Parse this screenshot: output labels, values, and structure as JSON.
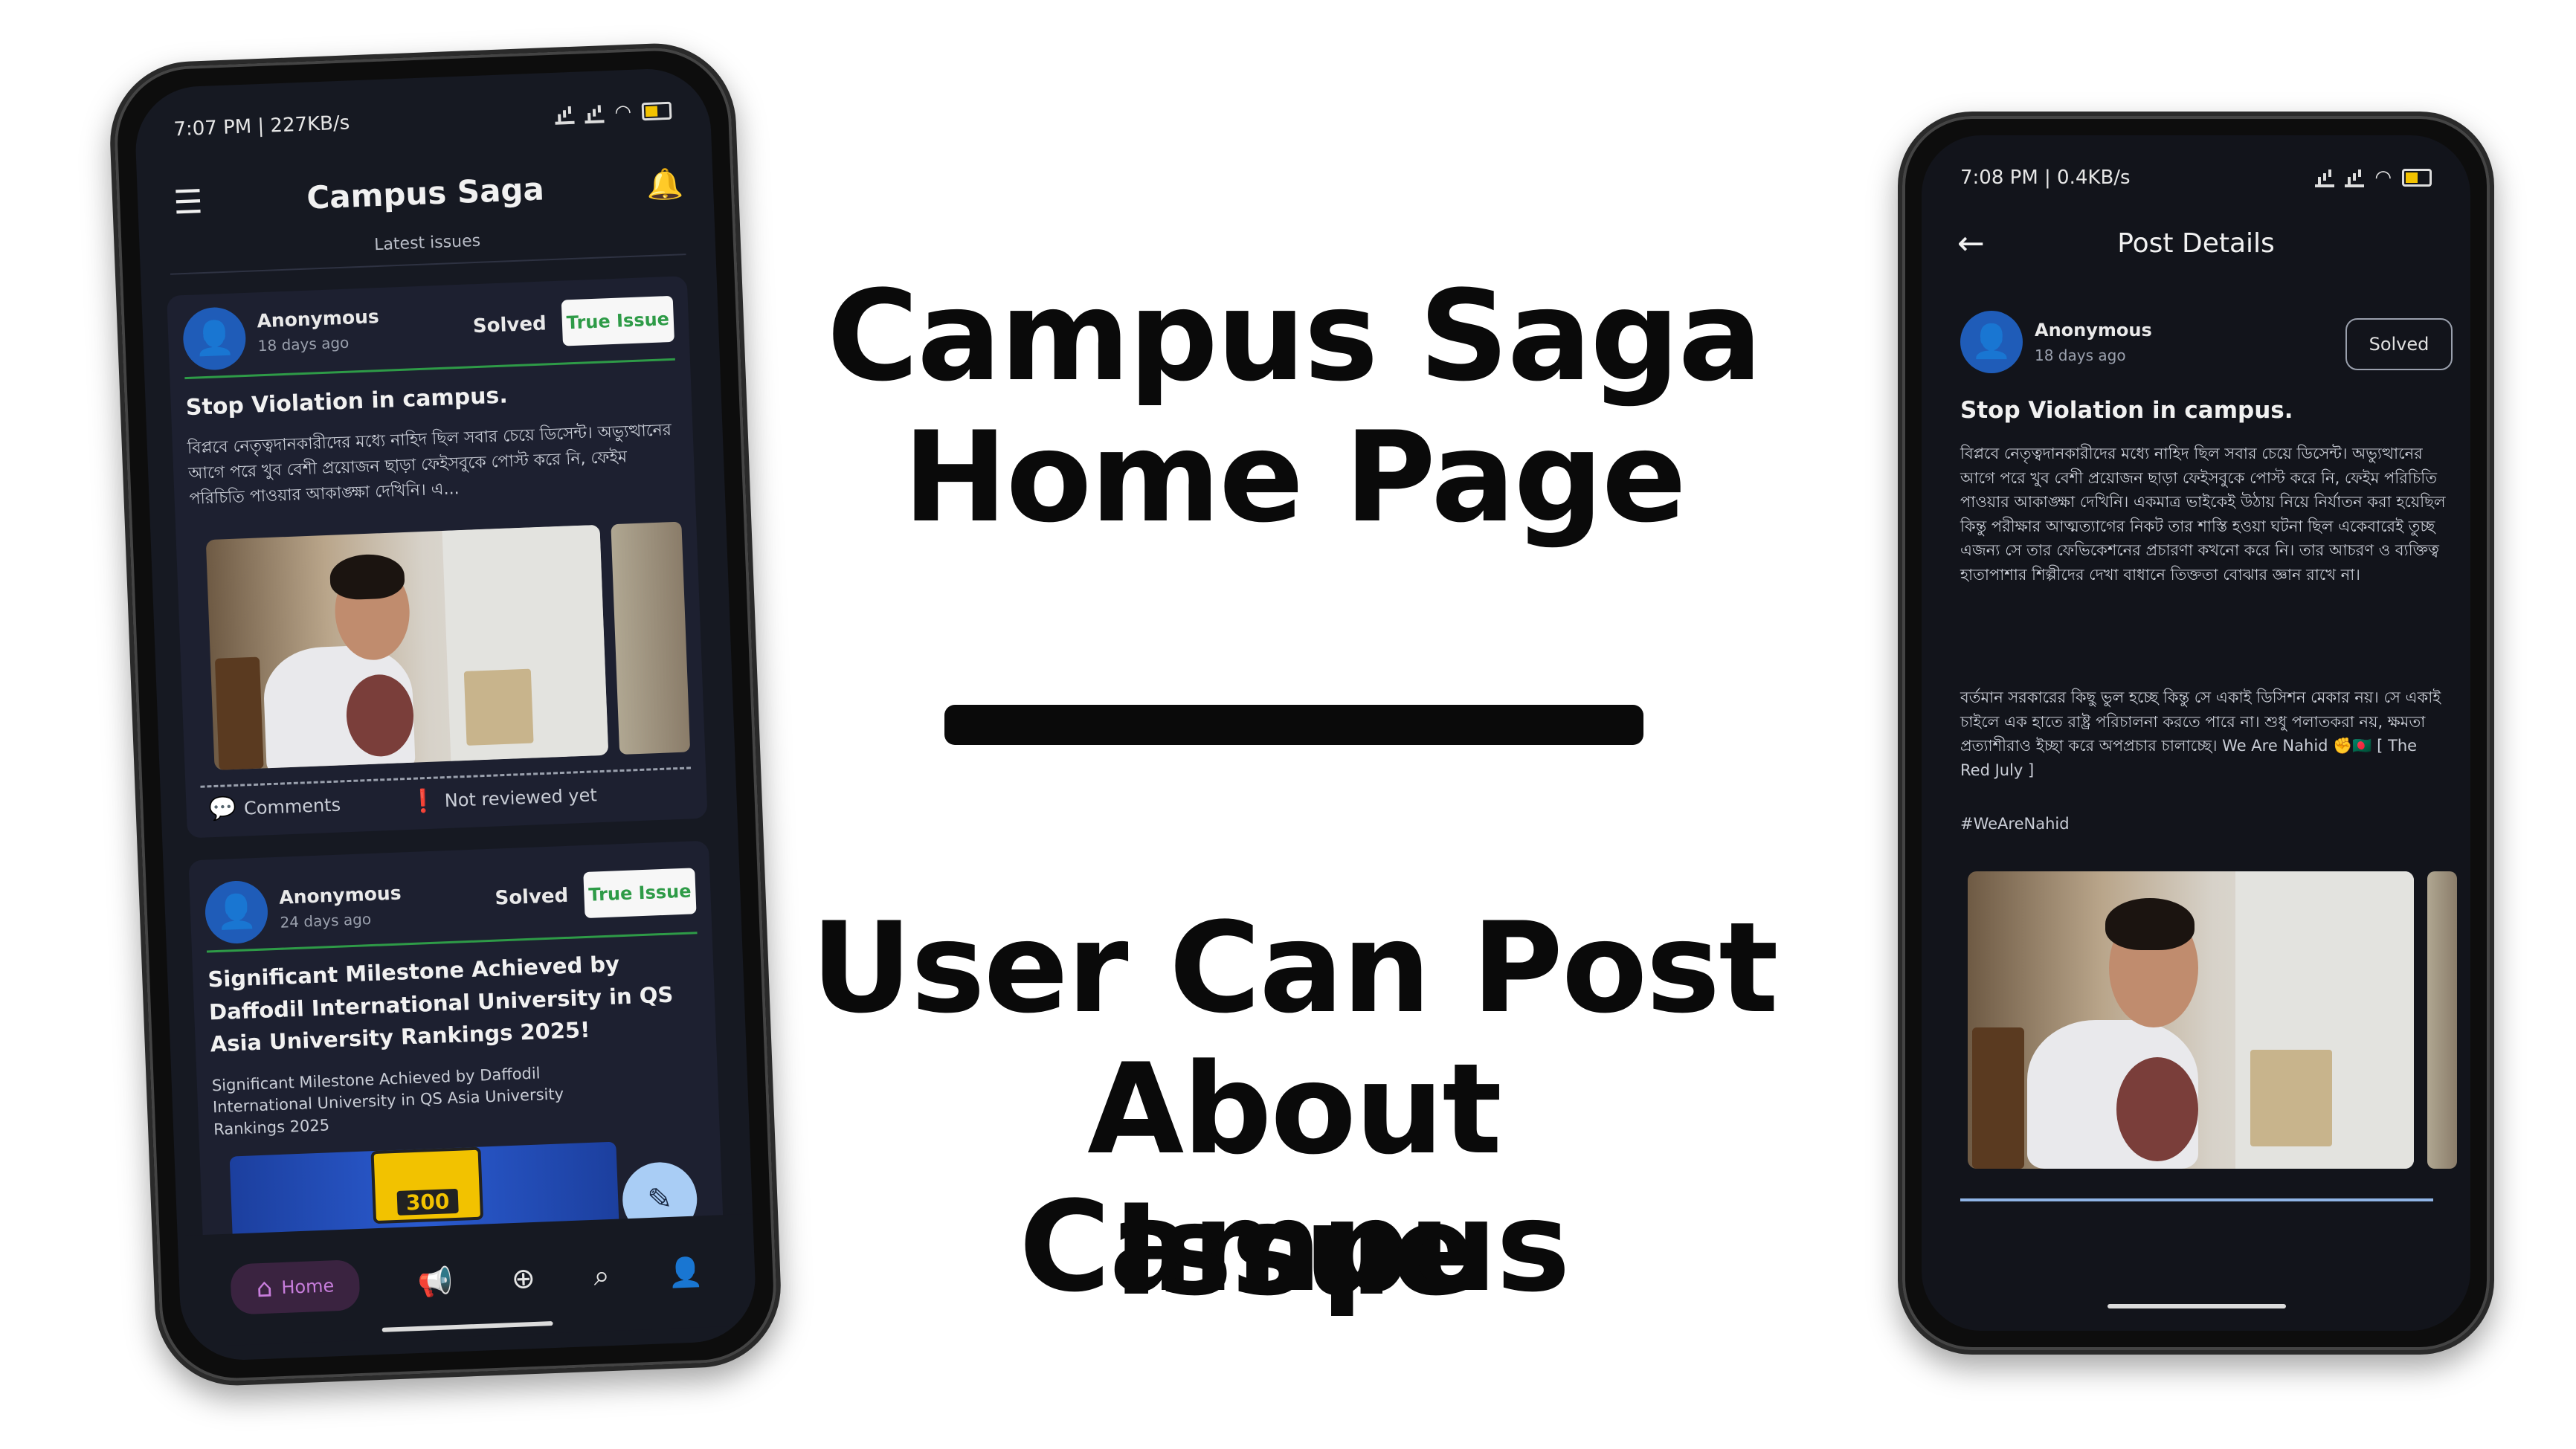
{
  "headline": {
    "line1": "Campus Saga",
    "line2": "Home Page"
  },
  "subheadline": {
    "line1": "User Can Post",
    "line2": "About Campus",
    "line3": "Issue"
  },
  "left_phone": {
    "status": {
      "time": "7:07 PM | 227KB/s"
    },
    "appbar": {
      "title": "Campus Saga",
      "subtitle": "Latest issues"
    },
    "post1": {
      "author": "Anonymous",
      "time": "18 days ago",
      "status": "Solved",
      "chip": "True Issue",
      "title": "Stop Violation in campus.",
      "body": "বিপ্লবে নেতৃত্বদানকারীদের মধ্যে নাহিদ ছিল সবার চেয়ে ডিসেন্ট। অভ্যুত্থানের আগে পরে খুব বেশী প্রয়োজন ছাড়া ফেইসবুকে পোস্ট করে নি, ফেইম পরিচিতি পাওয়ার আকাঙ্ক্ষা দেখিনি। এ...",
      "comments": "Comments",
      "review": "Not reviewed yet"
    },
    "post2": {
      "author": "Anonymous",
      "time": "24 days ago",
      "status": "Solved",
      "chip": "True Issue",
      "title": "Significant Milestone Achieved by Daffodil International University in QS Asia University Rankings 2025!",
      "body": "Significant Milestone Achieved by Daffodil International University in QS Asia University Rankings 2025",
      "badge": "300"
    },
    "nav": {
      "home": "Home"
    }
  },
  "right_phone": {
    "status": {
      "time": "7:08 PM | 0.4KB/s"
    },
    "appbar": {
      "title": "Post Details"
    },
    "post": {
      "author": "Anonymous",
      "time": "18 days ago",
      "status": "Solved",
      "title": "Stop Violation in campus.",
      "para1": "বিপ্লবে নেতৃত্বদানকারীদের মধ্যে নাহিদ ছিল সবার চেয়ে ডিসেন্ট। অভ্যুত্থানের আগে পরে খুব বেশী প্রয়োজন ছাড়া ফেইসবুকে পোস্ট করে নি, ফেইম পরিচিতি পাওয়ার আকাঙ্ক্ষা দেখিনি। একমাত্র ভাইকেই উঠায় নিয়ে নির্যাতন করা হয়েছিল কিন্তু পরীক্ষার আত্মত্যাগের নিকট তার শাস্তি হওয়া ঘটনা ছিল একেবারেই তুচ্ছ এজন্য সে তার ফেভিকেশনের প্রচারণা কখনো করে নি। তার আচরণ ও ব্যক্তিত্ব হাতাপাশার শিল্পীদের দেখা বাধানে তিক্ততা বোঝার জ্ঞান রাখে না।",
      "para2": "বর্তমান সরকারের কিছু ভুল হচ্ছে কিন্তু সে একাই ডিসিশন মেকার নয়। সে একাই চাইলে এক হাতে রাষ্ট্র পরিচালনা করতে পারে না। শুধু পলাতকরা নয়, ক্ষমতা প্রত্যাশীরাও ইচ্ছা করে অপপ্রচার চালাচ্ছে। We Are Nahid ✊🇧🇩 [ The Red July ]",
      "hashtag": "#WeAreNahid"
    }
  }
}
